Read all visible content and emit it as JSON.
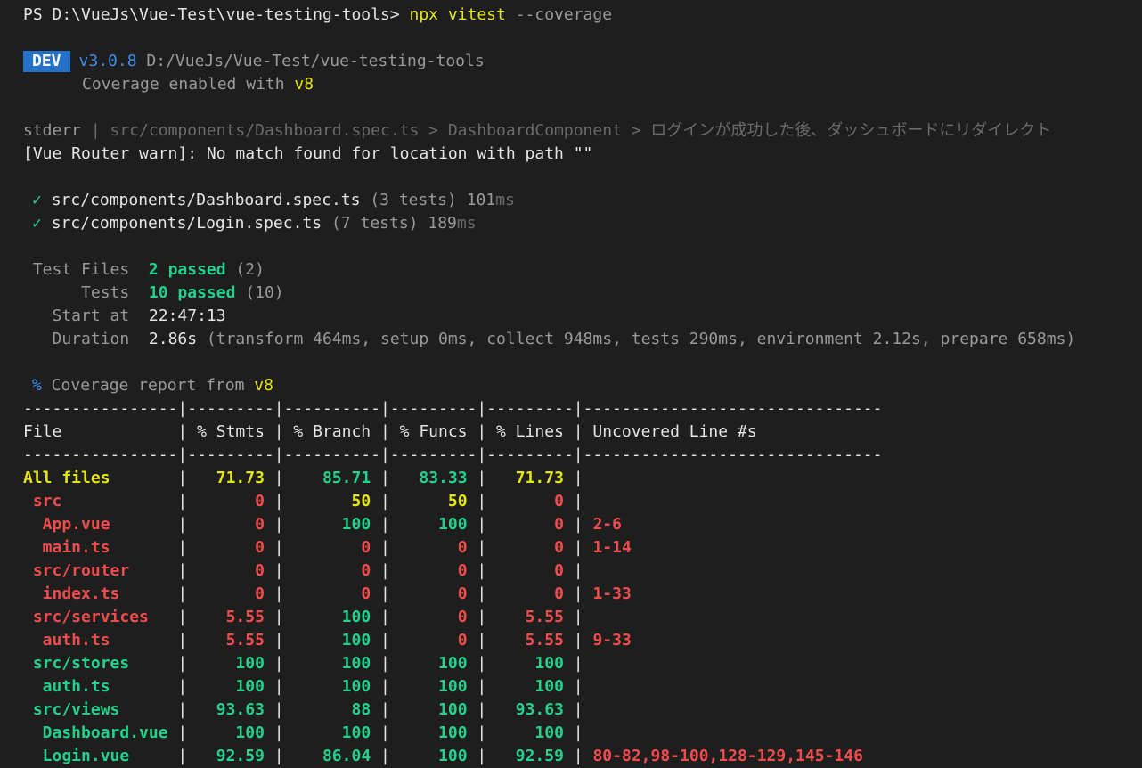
{
  "prompt": {
    "ps": "PS D:\\VueJs\\Vue-Test\\vue-testing-tools> ",
    "cmd": "npx vitest",
    "args": " --coverage"
  },
  "dev": {
    "badge": "DEV",
    "version": "v3.0.8",
    "path": "D:/VueJs/Vue-Test/vue-testing-tools",
    "coverage_prefix": "Coverage enabled with ",
    "coverage_engine": "v8"
  },
  "stderr": {
    "prefix": "stderr",
    "sep": " | ",
    "path": "src/components/Dashboard.spec.ts > DashboardComponent > ログインが成功した後、ダッシュボードにリダイレクト",
    "warn": "[Vue Router warn]: No match found for location with path \"\""
  },
  "specs": [
    {
      "check": "✓",
      "file": "src/components/Dashboard.spec.ts",
      "tests": "(3 tests)",
      "time": "101",
      "unit": "ms"
    },
    {
      "check": "✓",
      "file": "src/components/Login.spec.ts",
      "tests": "(7 tests)",
      "time": "189",
      "unit": "ms"
    }
  ],
  "summary": {
    "files_label": " Test Files  ",
    "files_value": "2 passed",
    "files_total": " (2)",
    "tests_label": "      Tests  ",
    "tests_value": "10 passed",
    "tests_total": " (10)",
    "start_label": "   Start at  ",
    "start_value": "22:47:13",
    "duration_label": "   Duration  ",
    "duration_value": "2.86s",
    "duration_detail": " (transform 464ms, setup 0ms, collect 948ms, tests 290ms, environment 2.12s, prepare 658ms)"
  },
  "coverage": {
    "symbol": "%",
    "label": " Coverage report from ",
    "engine": "v8",
    "divider": "----------------|---------|----------|---------|---------|-------------------------------",
    "header": "File            | % Stmts | % Branch | % Funcs | % Lines | Uncovered Line #s"
  },
  "colors": {
    "background": "#1e1e1e",
    "yellow": "#e5e510",
    "green": "#23d18b",
    "red": "#f14c4c",
    "blue": "#3b8eea",
    "badge": "#2472c8"
  },
  "rows": [
    {
      "name": "All files",
      "stmts": "71.73",
      "branch": "85.71",
      "funcs": "83.33",
      "lines": "71.73",
      "uncovered": "",
      "c": [
        "yellow",
        "yellow",
        "green",
        "green",
        "yellow"
      ],
      "bold": true
    },
    {
      "name": " src",
      "stmts": "0",
      "branch": "50",
      "funcs": "50",
      "lines": "0",
      "uncovered": "",
      "c": [
        "red",
        "red",
        "yellow",
        "yellow",
        "red"
      ],
      "bold": true
    },
    {
      "name": "  App.vue",
      "stmts": "0",
      "branch": "100",
      "funcs": "100",
      "lines": "0",
      "uncovered": "2-6",
      "c": [
        "red",
        "red",
        "green",
        "green",
        "red"
      ],
      "bold": true
    },
    {
      "name": "  main.ts",
      "stmts": "0",
      "branch": "0",
      "funcs": "0",
      "lines": "0",
      "uncovered": "1-14",
      "c": [
        "red",
        "red",
        "red",
        "red",
        "red"
      ],
      "bold": true
    },
    {
      "name": " src/router",
      "stmts": "0",
      "branch": "0",
      "funcs": "0",
      "lines": "0",
      "uncovered": "",
      "c": [
        "red",
        "red",
        "red",
        "red",
        "red"
      ],
      "bold": true
    },
    {
      "name": "  index.ts",
      "stmts": "0",
      "branch": "0",
      "funcs": "0",
      "lines": "0",
      "uncovered": "1-33",
      "c": [
        "red",
        "red",
        "red",
        "red",
        "red"
      ],
      "bold": true
    },
    {
      "name": " src/services",
      "stmts": "5.55",
      "branch": "100",
      "funcs": "0",
      "lines": "5.55",
      "uncovered": "",
      "c": [
        "red",
        "red",
        "green",
        "red",
        "red"
      ],
      "bold": true
    },
    {
      "name": "  auth.ts",
      "stmts": "5.55",
      "branch": "100",
      "funcs": "0",
      "lines": "5.55",
      "uncovered": "9-33",
      "c": [
        "red",
        "red",
        "green",
        "red",
        "red"
      ],
      "bold": true
    },
    {
      "name": " src/stores",
      "stmts": "100",
      "branch": "100",
      "funcs": "100",
      "lines": "100",
      "uncovered": "",
      "c": [
        "green",
        "green",
        "green",
        "green",
        "green"
      ],
      "bold": true
    },
    {
      "name": "  auth.ts",
      "stmts": "100",
      "branch": "100",
      "funcs": "100",
      "lines": "100",
      "uncovered": "",
      "c": [
        "green",
        "green",
        "green",
        "green",
        "green"
      ],
      "bold": true
    },
    {
      "name": " src/views",
      "stmts": "93.63",
      "branch": "88",
      "funcs": "100",
      "lines": "93.63",
      "uncovered": "",
      "c": [
        "green",
        "green",
        "green",
        "green",
        "green"
      ],
      "bold": true
    },
    {
      "name": "  Dashboard.vue",
      "stmts": "100",
      "branch": "100",
      "funcs": "100",
      "lines": "100",
      "uncovered": "",
      "c": [
        "green",
        "green",
        "green",
        "green",
        "green"
      ],
      "bold": true
    },
    {
      "name": "  Login.vue",
      "stmts": "92.59",
      "branch": "86.04",
      "funcs": "100",
      "lines": "92.59",
      "uncovered": "80-82,98-100,128-129,145-146",
      "c": [
        "green",
        "green",
        "green",
        "green",
        "green"
      ],
      "bold": true
    }
  ]
}
